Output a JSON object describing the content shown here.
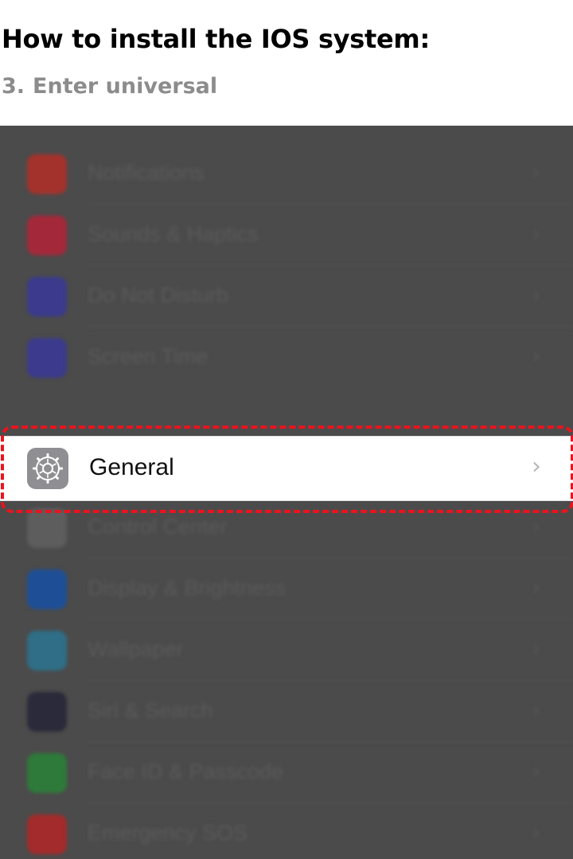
{
  "header": {
    "title": "How to install the IOS system:",
    "step_number": "3.",
    "step_text": "Enter universal"
  },
  "settings": {
    "group1": [
      {
        "label": "Notifications",
        "icon": "notifications-icon",
        "color": "#a3322c"
      },
      {
        "label": "Sounds & Haptics",
        "icon": "speaker-icon",
        "color": "#a3293a"
      },
      {
        "label": "Do Not Disturb",
        "icon": "moon-icon",
        "color": "#3b3a8c"
      },
      {
        "label": "Screen Time",
        "icon": "hourglass-icon",
        "color": "#3b3a8c"
      }
    ],
    "general": {
      "label": "General",
      "icon": "gear-icon",
      "chevron": "›"
    },
    "group2": [
      {
        "label": "Control Center",
        "icon": "switches-icon",
        "color": "#5d5d5d"
      },
      {
        "label": "Display & Brightness",
        "icon": "text-size-icon",
        "color": "#1e4f96"
      },
      {
        "label": "Wallpaper",
        "icon": "flower-icon",
        "color": "#2f6e86"
      },
      {
        "label": "Siri & Search",
        "icon": "siri-icon",
        "color": "#2a2a3a"
      },
      {
        "label": "Face ID & Passcode",
        "icon": "face-id-icon",
        "color": "#2e7a3a"
      },
      {
        "label": "Emergency SOS",
        "icon": "sos-icon",
        "color": "#a32b2b"
      }
    ],
    "chevron": "›"
  },
  "colors": {
    "highlight": "#e8141e",
    "overlay": "#4b4b4b",
    "general_icon_bg": "#8e8e93"
  }
}
